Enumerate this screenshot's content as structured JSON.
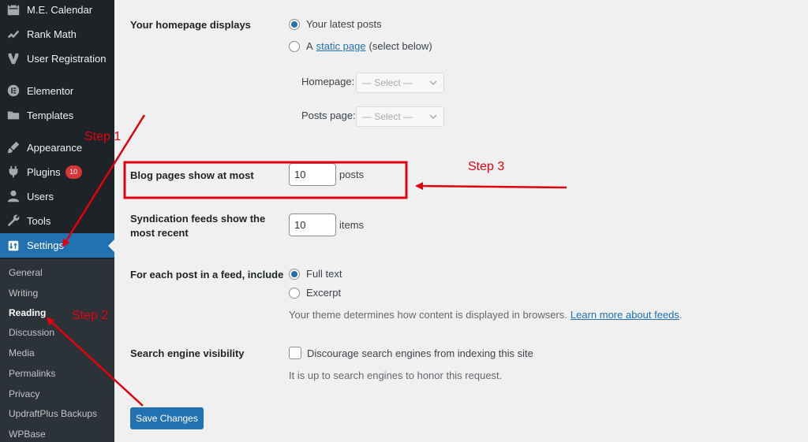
{
  "sidebar": {
    "items": [
      {
        "label": "M.E. Calendar",
        "icon": "calendar-icon"
      },
      {
        "label": "Rank Math",
        "icon": "rank-math-icon"
      },
      {
        "label": "User Registration",
        "icon": "user-registration-icon"
      },
      {
        "label": "Elementor",
        "icon": "elementor-icon"
      },
      {
        "label": "Templates",
        "icon": "folder-icon"
      },
      {
        "label": "Appearance",
        "icon": "paintbrush-icon"
      },
      {
        "label": "Plugins",
        "icon": "plugin-icon",
        "badge": "10"
      },
      {
        "label": "Users",
        "icon": "users-icon"
      },
      {
        "label": "Tools",
        "icon": "wrench-icon"
      },
      {
        "label": "Settings",
        "icon": "settings-icon",
        "active": true
      }
    ],
    "submenu": [
      "General",
      "Writing",
      "Reading",
      "Discussion",
      "Media",
      "Permalinks",
      "Privacy",
      "UpdraftPlus Backups",
      "WPBase"
    ],
    "current_submenu": "Reading"
  },
  "reading": {
    "homepage_displays": {
      "label": "Your homepage displays",
      "option_latest": "Your latest posts",
      "option_static_prefix": "A",
      "option_static_link": "static page",
      "option_static_suffix": "(select below)",
      "selected": "latest",
      "homepage_label": "Homepage:",
      "homepage_value": "— Select —",
      "posts_page_label": "Posts page:",
      "posts_page_value": "— Select —"
    },
    "blog_pages": {
      "label": "Blog pages show at most",
      "value": "10",
      "unit": "posts"
    },
    "syndication": {
      "label_line1": "Syndication feeds show the",
      "label_line2": "most recent",
      "value": "10",
      "unit": "items"
    },
    "feed_content": {
      "label": "For each post in a feed, include",
      "option_full": "Full text",
      "option_excerpt": "Excerpt",
      "selected": "full",
      "description_prefix": "Your theme determines how content is displayed in browsers.",
      "description_link": "Learn more about feeds",
      "description_suffix": "."
    },
    "search_visibility": {
      "label": "Search engine visibility",
      "checkbox_label": "Discourage search engines from indexing this site",
      "checked": false,
      "description": "It is up to search engines to honor this request."
    },
    "save_button": "Save Changes"
  },
  "annotations": {
    "step1": "Step 1",
    "step2": "Step 2",
    "step3": "Step 3",
    "color": "#e3000f"
  },
  "colors": {
    "sidebar_bg": "#1d2327",
    "submenu_bg": "#2c3338",
    "accent": "#2271b1",
    "page_bg": "#f0f0f1",
    "badge": "#d63638"
  }
}
